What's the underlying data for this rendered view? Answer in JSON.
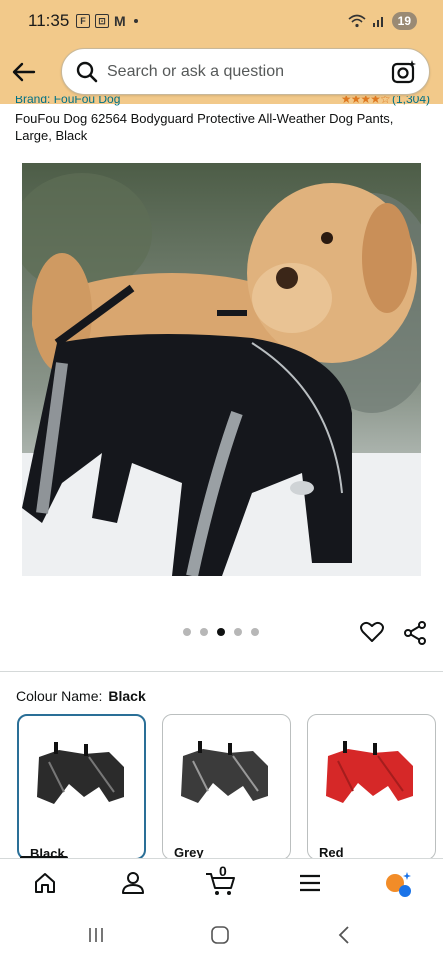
{
  "status": {
    "time": "11:35",
    "notification_icons": [
      "F",
      "⊡",
      "M"
    ],
    "battery": "19"
  },
  "search": {
    "placeholder": "Search or ask a question"
  },
  "product": {
    "brand": "Brand: FouFou Dog",
    "rating_count": "(1,304)",
    "title": "FouFou Dog 62564 Bodyguard Protective All-Weather Dog Pants, Large, Black"
  },
  "carousel": {
    "count": 5,
    "active": 3
  },
  "colour": {
    "label": "Colour Name:",
    "selected": "Black",
    "options": [
      {
        "name": "Black",
        "color": "#2b2b2b"
      },
      {
        "name": "Grey",
        "color": "#3b3b3b"
      },
      {
        "name": "Red",
        "color": "#d62828"
      }
    ]
  },
  "bottom_nav": {
    "cart_count": "0",
    "items": [
      "home-icon",
      "account-icon",
      "cart-icon",
      "menu-icon",
      "ai-assistant-icon"
    ]
  },
  "colors": {
    "header_bg": "#f2c98a",
    "link": "#007185",
    "star": "#de7921",
    "selected_border": "#2a6f97"
  }
}
